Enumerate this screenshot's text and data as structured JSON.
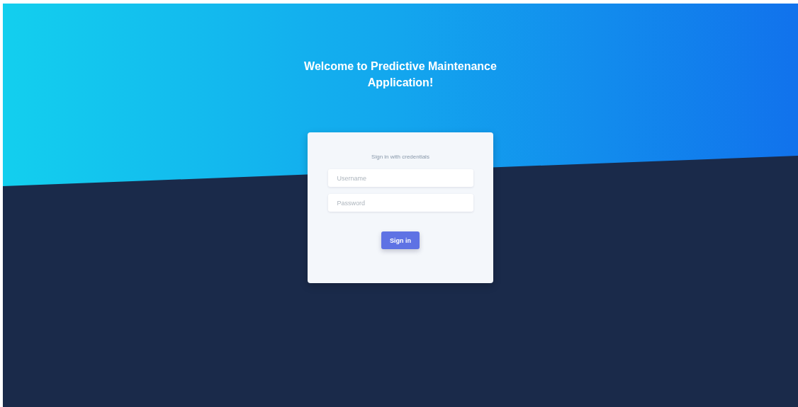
{
  "header": {
    "title": "Welcome to Predictive Maintenance Application!"
  },
  "login_card": {
    "subtitle": "Sign in with credentials",
    "fields": [
      {
        "placeholder": "Username"
      },
      {
        "placeholder": "Password"
      }
    ],
    "button": "Sign in"
  }
}
